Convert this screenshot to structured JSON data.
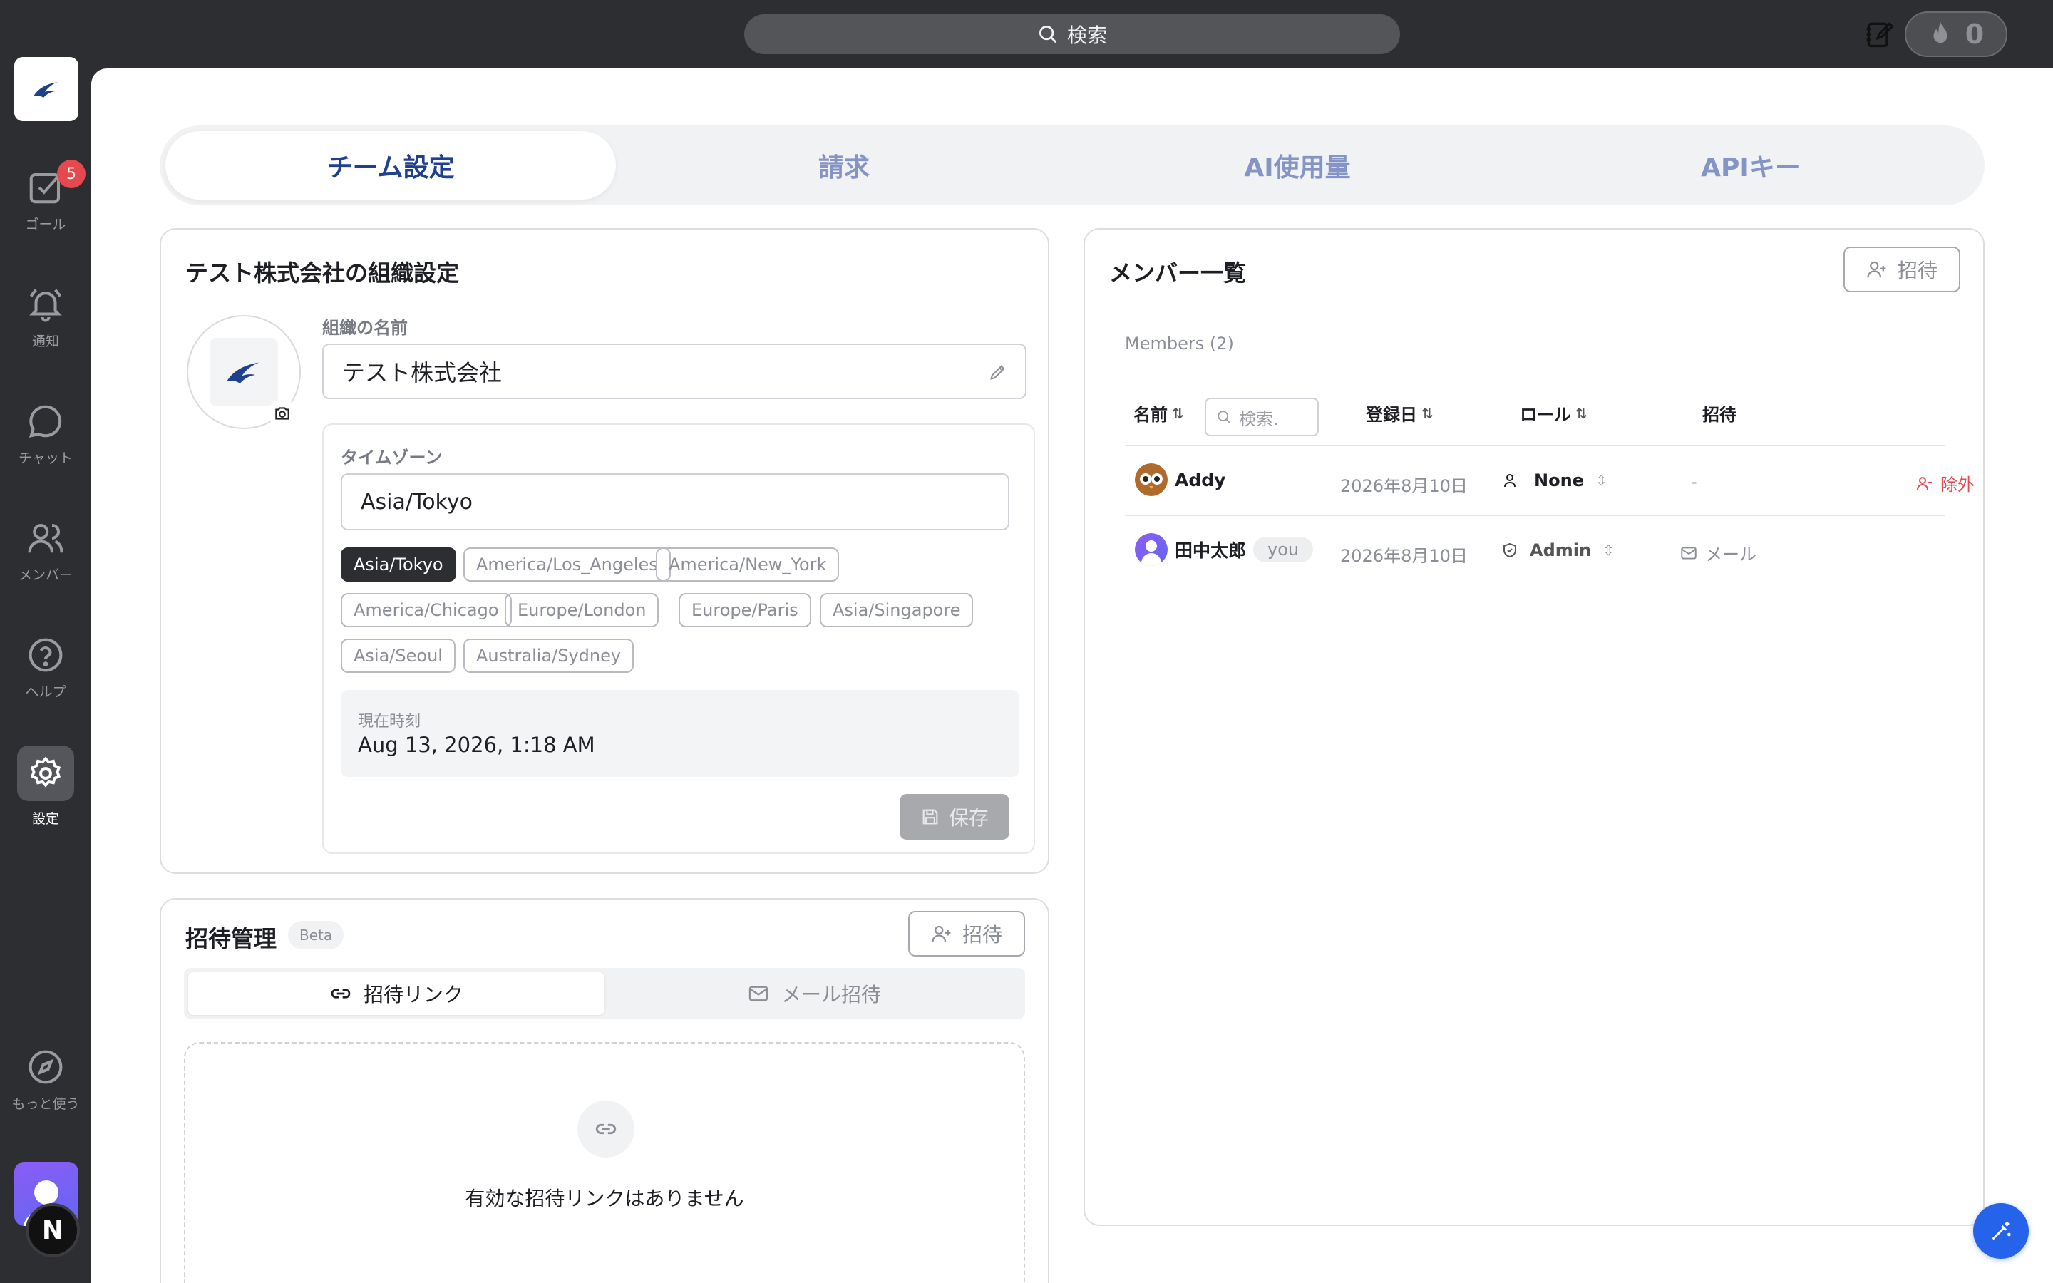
{
  "search": {
    "placeholder": "検索"
  },
  "streak": {
    "count": "0"
  },
  "sidebar": {
    "badge_count": "5",
    "items": [
      {
        "label": "ゴール",
        "icon": "checkbox-icon"
      },
      {
        "label": "通知",
        "icon": "bell-icon"
      },
      {
        "label": "チャット",
        "icon": "chat-bubble-icon"
      },
      {
        "label": "メンバー",
        "icon": "users-icon"
      },
      {
        "label": "ヘルプ",
        "icon": "help-circle-icon"
      },
      {
        "label": "設定",
        "icon": "gear-icon",
        "active": true
      },
      {
        "label": "もっと使う",
        "icon": "compass-icon"
      }
    ],
    "n_badge": "N"
  },
  "tabs": [
    "チーム設定",
    "請求",
    "AI使用量",
    "APIキー"
  ],
  "org": {
    "title": "テスト株式会社の組織設定",
    "name_label": "組織の名前",
    "name_value": "テスト株式会社",
    "tz_label": "タイムゾーン",
    "tz_value": "Asia/Tokyo",
    "tz_options": [
      "Asia/Tokyo",
      "America/Los_Angeles",
      "America/New_York",
      "America/Chicago",
      "Europe/London",
      "Europe/Paris",
      "Asia/Singapore",
      "Asia/Seoul",
      "Australia/Sydney"
    ],
    "now_label": "現在時刻",
    "now_value": "Aug 13, 2026, 1:18 AM",
    "save_label": "保存"
  },
  "invite": {
    "title": "招待管理",
    "beta": "Beta",
    "invite_button": "招待",
    "seg_link": "招待リンク",
    "seg_mail": "メール招待",
    "empty_text": "有効な招待リンクはありません"
  },
  "members": {
    "title": "メンバー一覧",
    "invite_button": "招待",
    "count_label": "Members (2)",
    "columns": {
      "name": "名前",
      "search_placeholder": "検索.",
      "joined": "登録日",
      "role": "ロール",
      "invite": "招待"
    },
    "sort_glyph": "⇅",
    "rows": [
      {
        "name": "Addy",
        "you": "",
        "joined": "2026年8月10日",
        "role": "None",
        "invite": "-",
        "action": "除外"
      },
      {
        "name": "田中太郎",
        "you": "you",
        "joined": "2026年8月10日",
        "role": "Admin",
        "invite": "メール",
        "action": ""
      }
    ]
  },
  "colors": {
    "accent_blue": "#1f3f8f",
    "danger": "#e5484d",
    "fab": "#2563eb",
    "sidebar": "#2d2e31"
  }
}
